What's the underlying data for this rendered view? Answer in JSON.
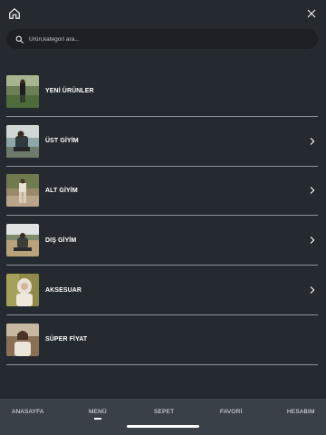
{
  "header": {
    "home_icon": "home-icon",
    "close_icon": "close-icon"
  },
  "search": {
    "placeholder": "Ürün,kategori ara..."
  },
  "menu": {
    "items": [
      {
        "label": "YENİ ÜRÜNLER",
        "has_chevron": false
      },
      {
        "label": "ÜST GİYİM",
        "has_chevron": true
      },
      {
        "label": "ALT GİYİM",
        "has_chevron": true
      },
      {
        "label": "DIŞ GİYİM",
        "has_chevron": true
      },
      {
        "label": "AKSESUAR",
        "has_chevron": true
      },
      {
        "label": "SÜPER FİYAT",
        "has_chevron": false
      }
    ]
  },
  "bottom_nav": {
    "items": [
      {
        "label": "ANASAYFA"
      },
      {
        "label": "MENÜ",
        "active": true
      },
      {
        "label": "SEPET"
      },
      {
        "label": "FAVORİ"
      },
      {
        "label": "HESABIM"
      }
    ]
  },
  "colors": {
    "background": "#252a30",
    "search_bg": "#1c2025",
    "nav_bg": "#3a4047",
    "divider": "#8e939a",
    "text": "#ffffff"
  }
}
